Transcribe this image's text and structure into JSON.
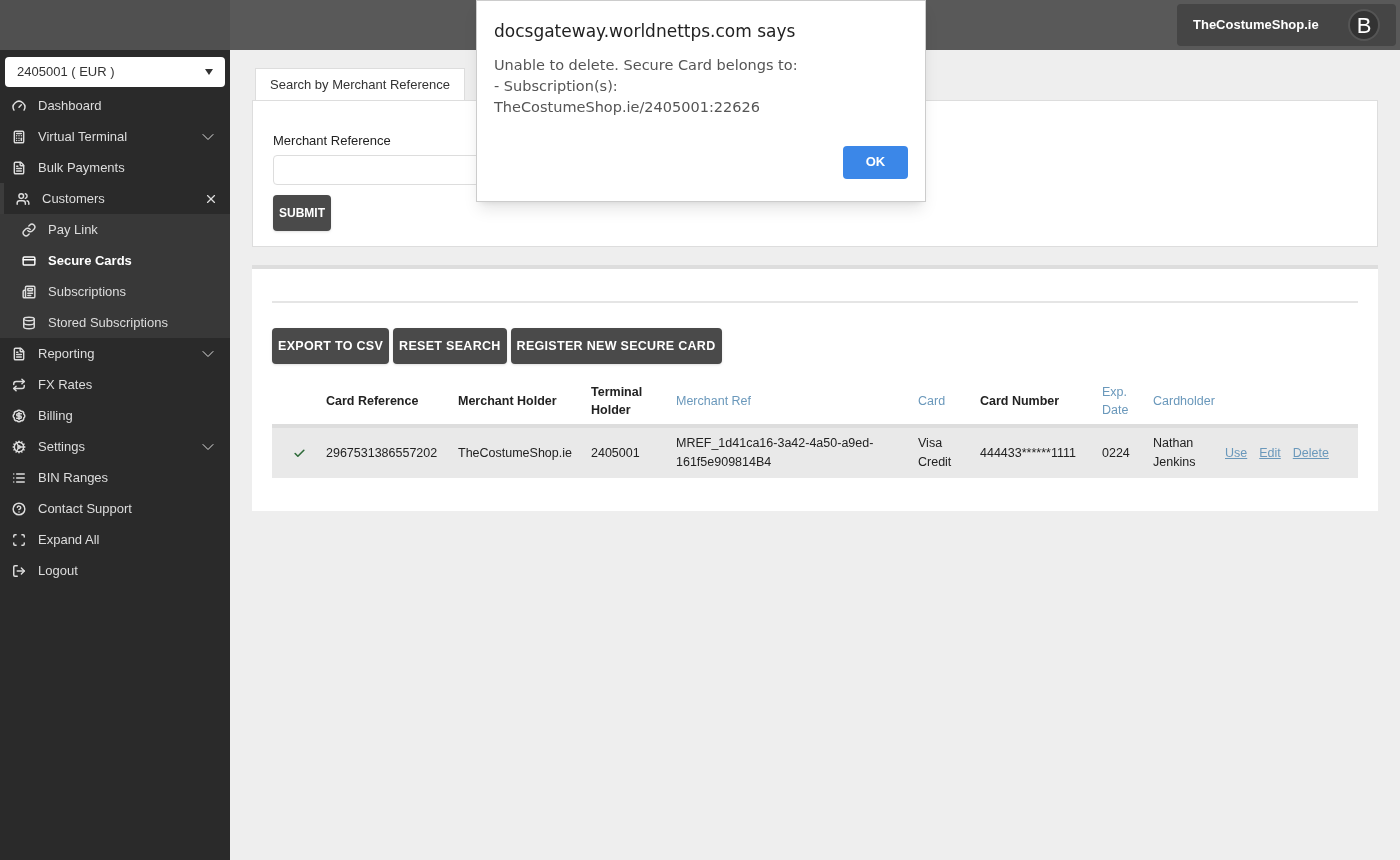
{
  "account_select": {
    "value": "2405001 ( EUR )"
  },
  "user": {
    "name": "TheCostumeShop.ie",
    "initial": "B"
  },
  "sidebar": {
    "items": [
      {
        "label": "Dashboard",
        "kind": "link",
        "selected": false
      },
      {
        "label": "Virtual Terminal",
        "kind": "group",
        "expanded": false,
        "selected": false
      },
      {
        "label": "Bulk Payments",
        "kind": "link",
        "selected": false
      },
      {
        "label": "Customers",
        "kind": "group",
        "expanded": true,
        "selected": false,
        "children": [
          {
            "label": "Pay Link",
            "selected": false
          },
          {
            "label": "Secure Cards",
            "selected": true
          },
          {
            "label": "Subscriptions",
            "selected": false
          },
          {
            "label": "Stored Subscriptions",
            "selected": false
          }
        ]
      },
      {
        "label": "Reporting",
        "kind": "group",
        "expanded": false,
        "selected": false
      },
      {
        "label": "FX Rates",
        "kind": "link",
        "selected": false
      },
      {
        "label": "Billing",
        "kind": "link",
        "selected": false
      },
      {
        "label": "Settings",
        "kind": "group",
        "expanded": false,
        "selected": false
      },
      {
        "label": "BIN Ranges",
        "kind": "link",
        "selected": false
      },
      {
        "label": "Contact Support",
        "kind": "link",
        "selected": false
      },
      {
        "label": "Expand All",
        "kind": "link",
        "selected": false
      },
      {
        "label": "Logout",
        "kind": "link",
        "selected": false
      }
    ]
  },
  "tabs": [
    {
      "label": "Search by Merchant Reference",
      "selected": true
    }
  ],
  "search_form": {
    "label": "Merchant Reference",
    "submit": "SUBMIT"
  },
  "actions": [
    "EXPORT TO CSV",
    "RESET SEARCH",
    "REGISTER NEW SECURE CARD"
  ],
  "table": {
    "columns": [
      {
        "label": "Card Reference",
        "sortable": false
      },
      {
        "label": "Merchant Holder",
        "sortable": false
      },
      {
        "label": "Terminal Holder",
        "sortable": false
      },
      {
        "label": "Merchant Ref",
        "sortable": true
      },
      {
        "label": "Card",
        "sortable": true
      },
      {
        "label": "Card Number",
        "sortable": false
      },
      {
        "label": "Exp. Date",
        "sortable": true
      },
      {
        "label": "Cardholder",
        "sortable": true
      }
    ],
    "rows": [
      {
        "checked": true,
        "cells": [
          "2967531386557202",
          "TheCostumeShop.ie",
          "2405001",
          "MREF_1d41ca16-3a42-4a50-a9ed-161f5e909814B4",
          "Visa Credit",
          "444433******1111",
          "0224",
          "Nathan Jenkins"
        ],
        "links": [
          "Use",
          "Edit",
          "Delete"
        ]
      }
    ]
  },
  "dialog": {
    "title": "docsgateway.worldnettps.com says",
    "lines": [
      "Unable to delete. Secure Card belongs to:",
      "- Subscription(s):",
      "TheCostumeShop.ie/2405001:22626"
    ],
    "button": "OK"
  }
}
